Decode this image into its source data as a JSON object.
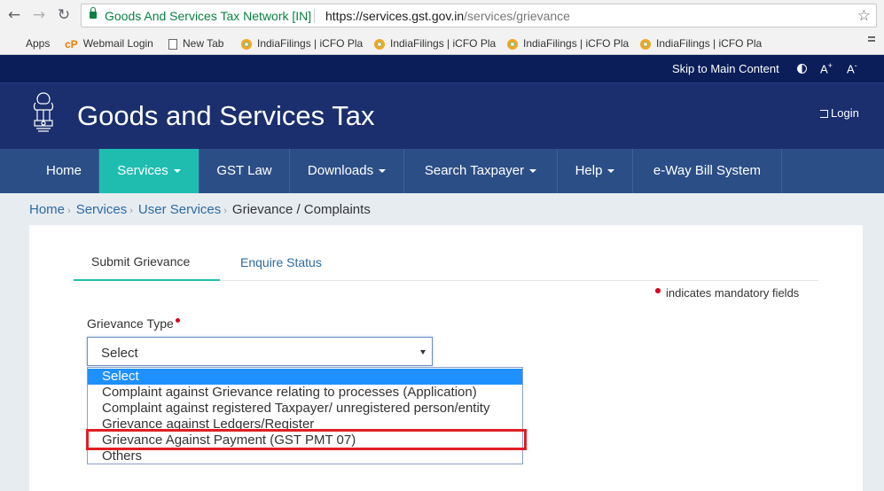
{
  "browser": {
    "back_icon": "arrow-left-icon",
    "forward_icon": "arrow-right-icon",
    "reload_icon": "reload-icon",
    "secure_label": "Goods And Services Tax Network [IN]",
    "url_base": "https://services.gst.gov.in",
    "url_path": "/services/grievance",
    "bookmark_icon": "star-icon"
  },
  "bookmarks": [
    {
      "label": "Apps",
      "icon": "apps-grid-icon"
    },
    {
      "label": "Webmail Login",
      "icon": "cpanel-icon"
    },
    {
      "label": "New Tab",
      "icon": "page-icon"
    },
    {
      "label": "IndiaFilings | iCFO Pla",
      "icon": "indiafilings-icon"
    },
    {
      "label": "IndiaFilings | iCFO Pla",
      "icon": "indiafilings-icon"
    },
    {
      "label": "IndiaFilings | iCFO Pla",
      "icon": "indiafilings-icon"
    },
    {
      "label": "IndiaFilings | iCFO Pla",
      "icon": "indiafilings-icon"
    }
  ],
  "topbar": {
    "skip": "Skip to Main Content",
    "font_increase": "A+",
    "font_decrease": "A-"
  },
  "header": {
    "title": "Goods and Services Tax",
    "login": "Login"
  },
  "nav": {
    "items": [
      "Home",
      "Services",
      "GST Law",
      "Downloads",
      "Search Taxpayer",
      "Help",
      "e-Way Bill System"
    ],
    "active": "Services"
  },
  "breadcrumb": {
    "items": [
      "Home",
      "Services",
      "User Services"
    ],
    "current": "Grievance / Complaints"
  },
  "tabs": {
    "submit": "Submit Grievance",
    "enquire": "Enquire Status"
  },
  "form": {
    "mandatory_note": "indicates mandatory fields",
    "grievance_label": "Grievance Type",
    "selected_value": "Select",
    "options": [
      "Select",
      "Complaint against Grievance relating to processes (Application)",
      "Complaint against registered Taxpayer/ unregistered person/entity",
      "Grievance against Ledgers/Register",
      "Grievance Against Payment (GST PMT 07)",
      "Others"
    ]
  },
  "colors": {
    "accent": "#1fbdb0",
    "nav": "#2c4e86",
    "header": "#1b2f6e",
    "highlight": "#e01e24"
  }
}
